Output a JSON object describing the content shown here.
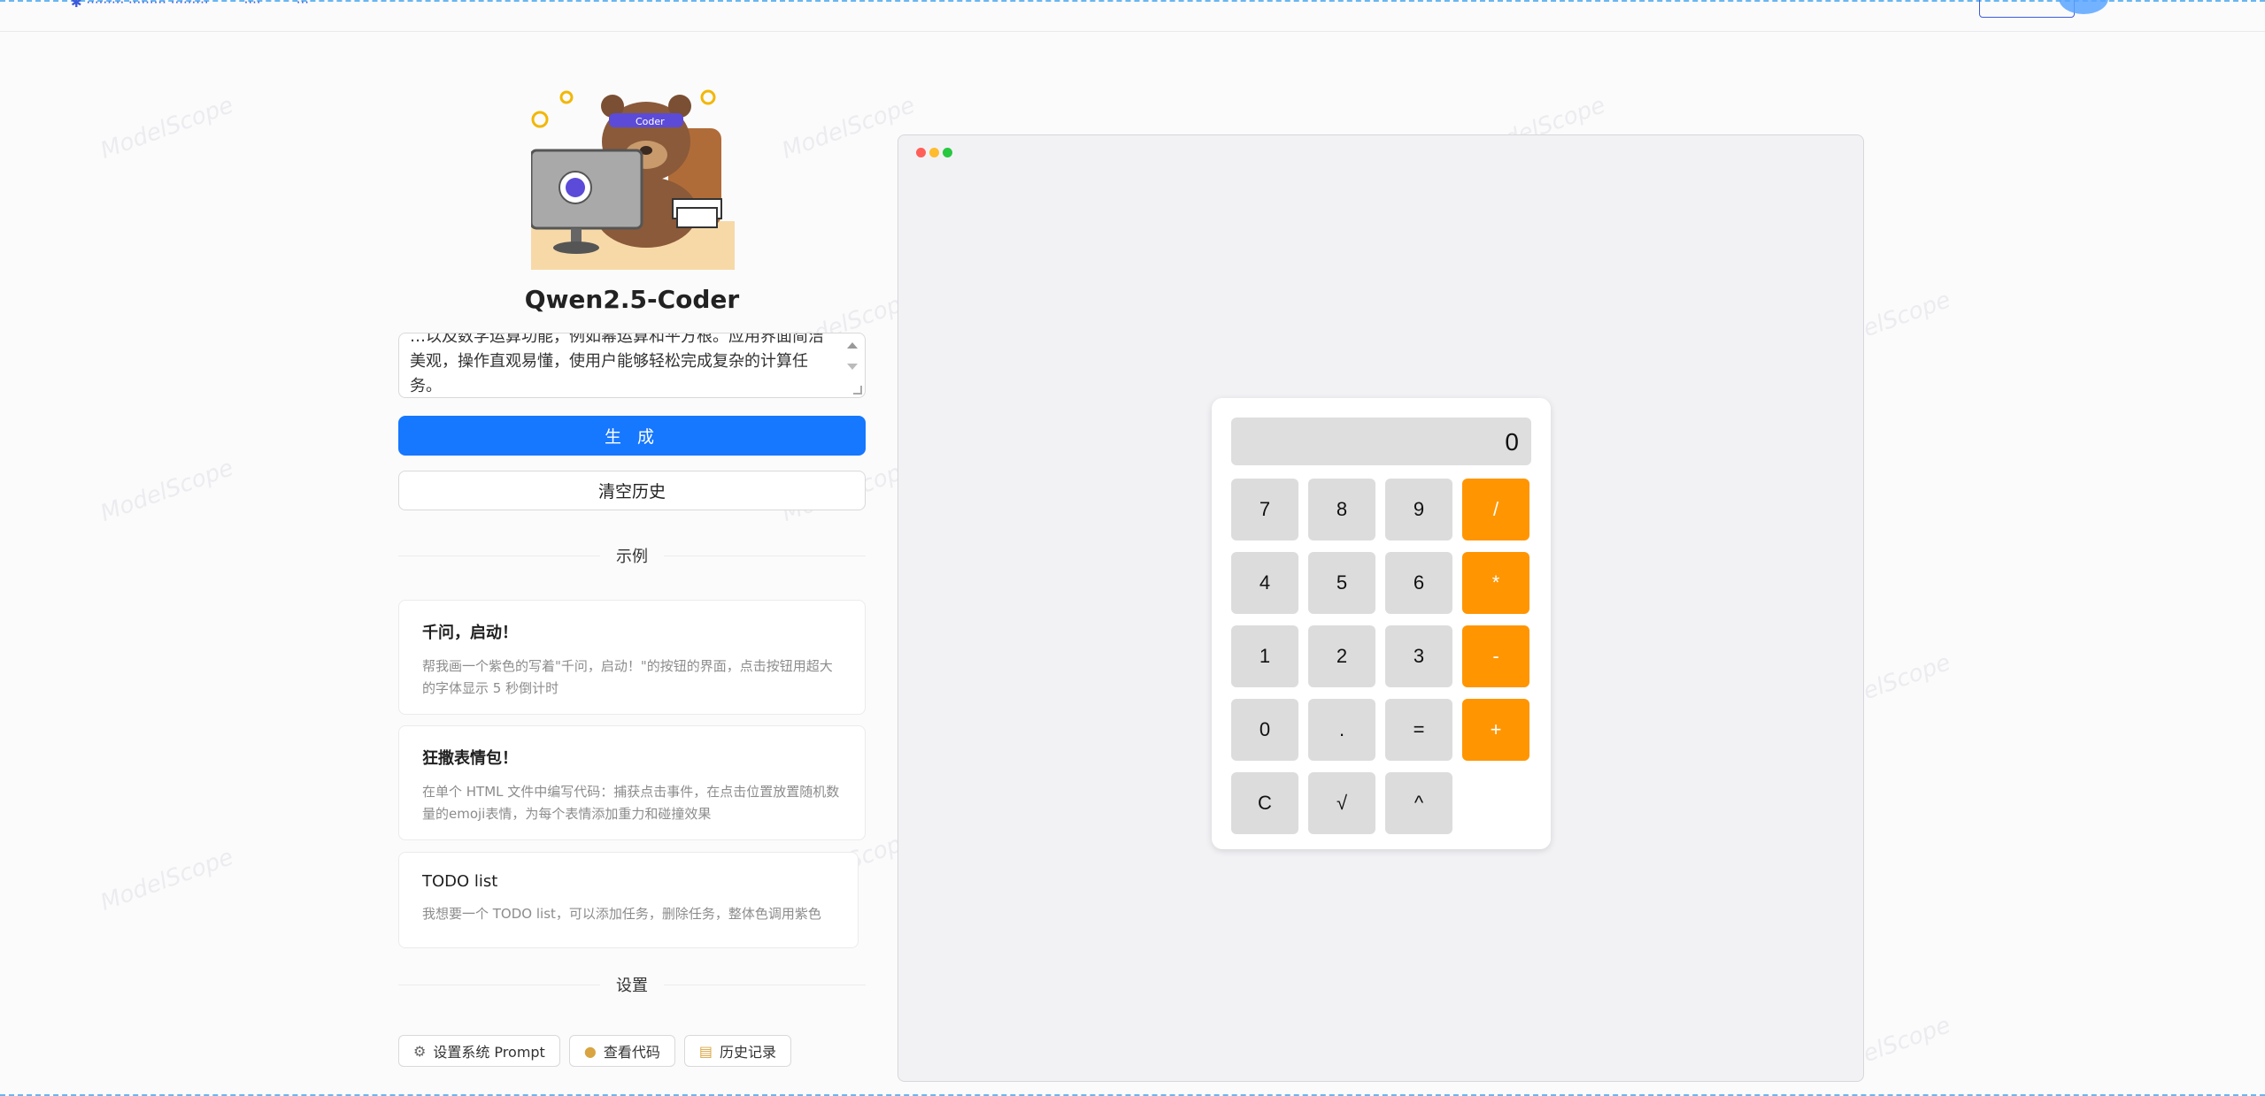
{
  "app": {
    "title": "Qwen2.5-Coder",
    "prompt_text": "…以及数学运算功能，例如幂运算和平方根。应用界面简洁美观，操作直观易懂，使用户能够轻松完成复杂的计算任务。"
  },
  "actions": {
    "generate_label": "生 成",
    "clear_label": "清空历史"
  },
  "examples": {
    "section_label": "示例",
    "items": [
      {
        "title": "千问，启动！",
        "desc": "帮我画一个紫色的写着\"千问，启动！\"的按钮的界面，点击按钮用超大的字体显示 5 秒倒计时"
      },
      {
        "title": "狂撒表情包！",
        "desc": "在单个 HTML 文件中编写代码：捕获点击事件，在点击位置放置随机数量的emoji表情，为每个表情添加重力和碰撞效果"
      },
      {
        "title": "TODO list",
        "desc": "我想要一个 TODO list，可以添加任务，删除任务，整体色调用紫色"
      }
    ]
  },
  "settings": {
    "section_label": "设置",
    "buttons": [
      {
        "label": "设置系统 Prompt",
        "icon": "gear-icon"
      },
      {
        "label": "查看代码",
        "icon": "user-icon"
      },
      {
        "label": "历史记录",
        "icon": "scroll-icon"
      }
    ]
  },
  "preview": {
    "window_dot_colors": [
      "#ff5f57",
      "#febc2e",
      "#28c840"
    ],
    "calculator": {
      "display": "0",
      "keys": [
        "7",
        "8",
        "9",
        "/",
        "4",
        "5",
        "6",
        "*",
        "1",
        "2",
        "3",
        "-",
        "0",
        ".",
        "=",
        "+",
        "C",
        "√",
        "^"
      ],
      "operator_color": "#ff9500",
      "key_color": "#dcdcdc"
    }
  },
  "watermark": "ModelScope",
  "colors": {
    "primary": "#1677ff"
  }
}
